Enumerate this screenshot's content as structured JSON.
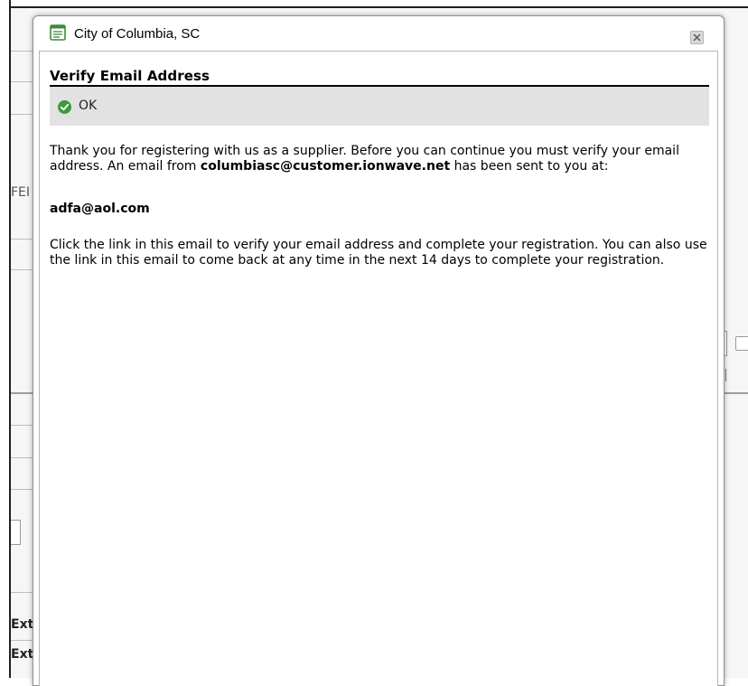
{
  "window": {
    "title": "City of Columbia, SC",
    "icon": "document-icon",
    "close_icon": "close-icon"
  },
  "dialog": {
    "heading": "Verify Email Address",
    "status": {
      "icon": "check-circle-icon",
      "text": "OK",
      "color": "#3a9b3a"
    },
    "message": {
      "intro": "Thank you for registering with us as a supplier. Before you can continue you must verify your email address. An email from ",
      "sender": "columbiasc@customer.ionwave.net",
      "intro_suffix": " has been sent to you at:",
      "recipient": "adfa@aol.com",
      "instructions": "Click the link in this email to verify your email address and complete your registration. You can also use the link in this email to come back at any time in the next 14 days to complete your registration."
    }
  },
  "background": {
    "fragments": [
      "FEI",
      "Ext",
      "Ext"
    ]
  }
}
